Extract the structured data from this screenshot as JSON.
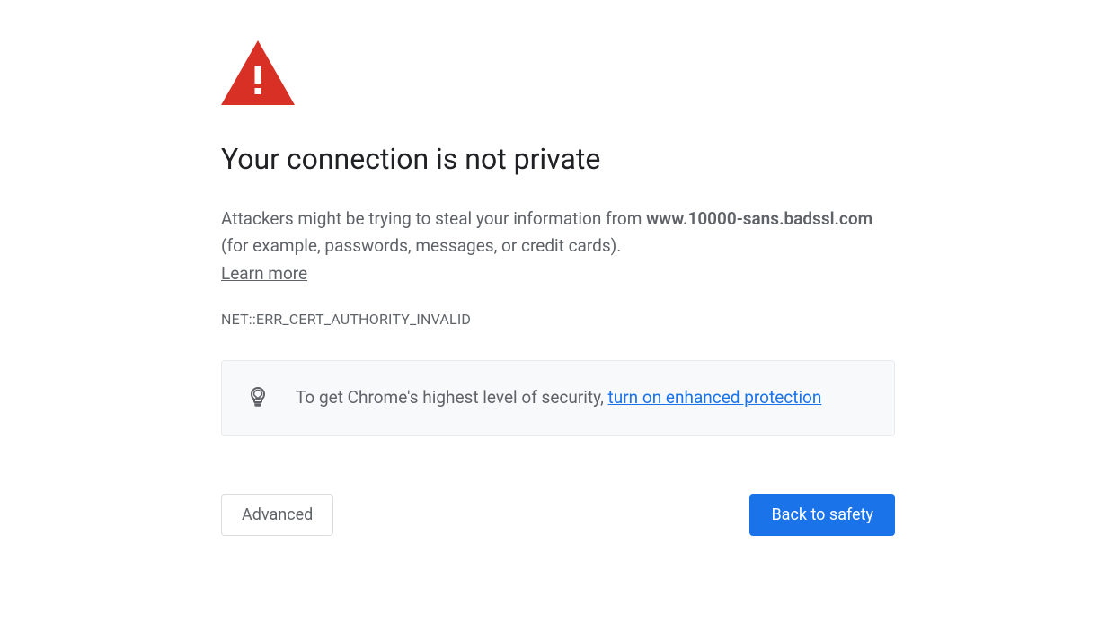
{
  "heading": "Your connection is not private",
  "body": {
    "prefix": "Attackers might be trying to steal your information from ",
    "domain": "www.10000-sans.badssl.com",
    "suffix": " (for example, passwords, messages, or credit cards). ",
    "learn_more": "Learn more"
  },
  "error_code": "NET::ERR_CERT_AUTHORITY_INVALID",
  "tip": {
    "prefix": "To get Chrome's highest level of security, ",
    "link": "turn on enhanced protection"
  },
  "buttons": {
    "advanced": "Advanced",
    "back": "Back to safety"
  },
  "colors": {
    "danger": "#d93025",
    "primary": "#1a73e8",
    "text_secondary": "#5f6368"
  }
}
